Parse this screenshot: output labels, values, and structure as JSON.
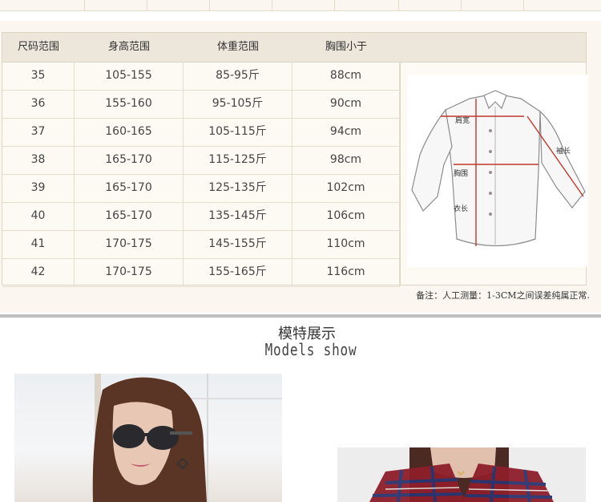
{
  "prev_table_row": [
    "",
    "",
    "",
    "",
    "",
    "",
    "",
    ""
  ],
  "size_table": {
    "headers": [
      "尺码范围",
      "身高范围",
      "体重范围",
      "胸围小于"
    ],
    "rows": [
      [
        "35",
        "105-155",
        "85-95斤",
        "88cm"
      ],
      [
        "36",
        "155-160",
        "95-105斤",
        "90cm"
      ],
      [
        "37",
        "160-165",
        "105-115斤",
        "94cm"
      ],
      [
        "38",
        "165-170",
        "115-125斤",
        "98cm"
      ],
      [
        "39",
        "165-170",
        "125-135斤",
        "102cm"
      ],
      [
        "40",
        "165-170",
        "135-145斤",
        "106cm"
      ],
      [
        "41",
        "170-175",
        "145-155斤",
        "110cm"
      ],
      [
        "42",
        "170-175",
        "155-165斤",
        "116cm"
      ]
    ]
  },
  "diagram": {
    "shoulder_label": "肩宽",
    "sleeve_label": "袖长",
    "chest_label": "胸围",
    "length_label": "衣长"
  },
  "note": "备注：人工测量：1-3CM之间误差纯属正常.",
  "section": {
    "title_cn": "模特展示",
    "title_en": "Models show"
  },
  "colors": {
    "background": "#fbf7f0",
    "header": "#ece6db",
    "measure_line": "#c0392b",
    "divider": "#bfbfbf"
  }
}
